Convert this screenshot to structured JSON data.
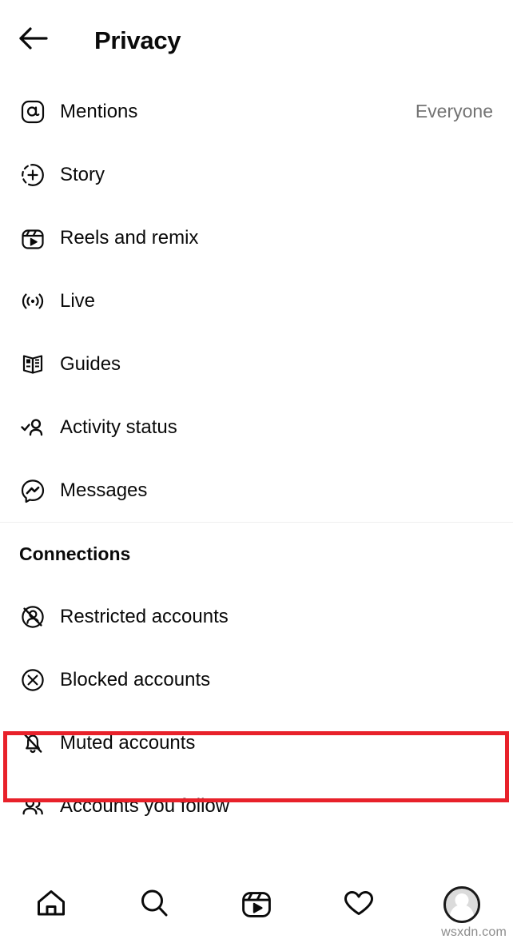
{
  "header": {
    "back_icon": "arrow-left-icon",
    "title": "Privacy"
  },
  "main": {
    "interactions": [
      {
        "icon": "mention-at-icon",
        "label": "Mentions",
        "value": "Everyone"
      },
      {
        "icon": "story-plus-icon",
        "label": "Story",
        "value": ""
      },
      {
        "icon": "reels-clapper-icon",
        "label": "Reels and remix",
        "value": ""
      },
      {
        "icon": "live-broadcast-icon",
        "label": "Live",
        "value": ""
      },
      {
        "icon": "guides-book-icon",
        "label": "Guides",
        "value": ""
      },
      {
        "icon": "activity-status-icon",
        "label": "Activity status",
        "value": ""
      },
      {
        "icon": "messenger-icon",
        "label": "Messages",
        "value": ""
      }
    ],
    "connections_section": {
      "title": "Connections",
      "items": [
        {
          "icon": "restricted-account-icon",
          "label": "Restricted accounts",
          "value": ""
        },
        {
          "icon": "blocked-account-icon",
          "label": "Blocked accounts",
          "value": ""
        },
        {
          "icon": "muted-bell-icon",
          "label": "Muted accounts",
          "value": "",
          "highlighted": true
        },
        {
          "icon": "accounts-you-follow-icon",
          "label": "Accounts you follow",
          "value": ""
        }
      ]
    }
  },
  "bottom_nav": {
    "items": [
      {
        "icon": "home-icon",
        "label": "Home"
      },
      {
        "icon": "search-icon",
        "label": "Search"
      },
      {
        "icon": "reels-icon",
        "label": "Reels"
      },
      {
        "icon": "heart-icon",
        "label": "Activity"
      },
      {
        "icon": "profile-avatar-icon",
        "label": "Profile"
      }
    ]
  },
  "watermark": "wsxdn.com",
  "colors": {
    "highlight_red": "#e8212a",
    "text_primary": "#0a0a0a",
    "text_secondary": "#737373",
    "divider": "#efefef"
  }
}
